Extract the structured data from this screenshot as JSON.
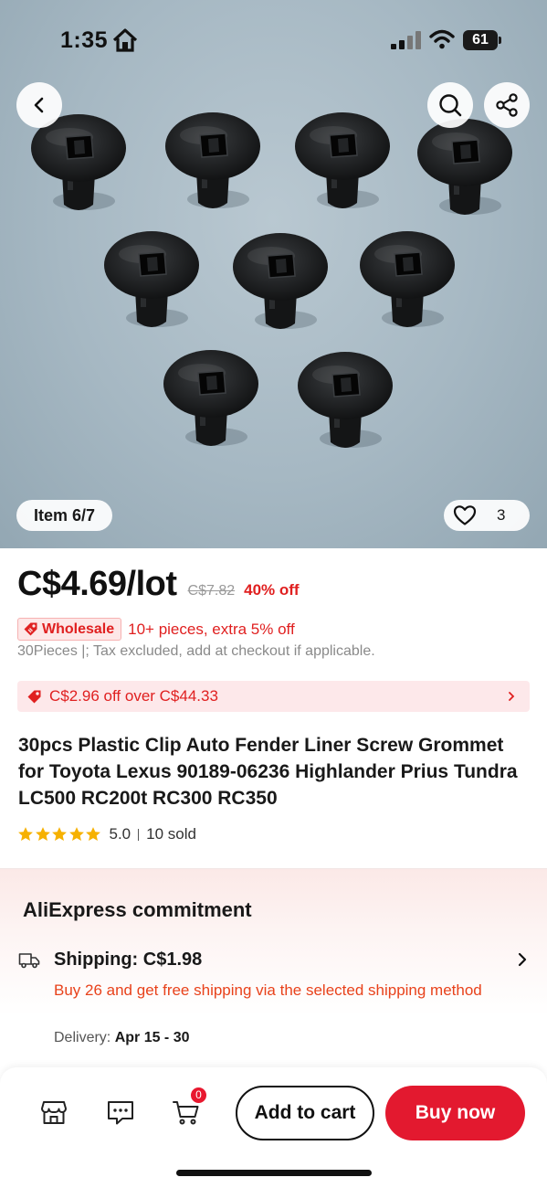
{
  "status_bar": {
    "time": "1:35",
    "battery": "61"
  },
  "gallery": {
    "item_indicator": "Item 6/7",
    "like_count": "3"
  },
  "pricing": {
    "price": "C$4.69",
    "unit": "/lot",
    "original_price": "C$7.82",
    "discount": "40% off",
    "wholesale_badge": "Wholesale",
    "wholesale_offer": "10+ pieces, extra 5% off",
    "tax_note": "30Pieces |; Tax excluded, add at checkout if applicable."
  },
  "coupon": {
    "text": "C$2.96 off over C$44.33"
  },
  "product": {
    "title": "30pcs Plastic Clip Auto Fender Liner Screw Grommet for Toyota Lexus 90189-06236 Highlander Prius Tundra LC500 RC200t RC300 RC350",
    "rating": "5.0",
    "rating_stars": 5,
    "sold": "10 sold"
  },
  "commitment": {
    "title": "AliExpress commitment",
    "shipping_label": "Shipping: C$1.98",
    "shipping_promo": "Buy 26 and get free shipping via the selected shipping method",
    "delivery_label": "Delivery:",
    "delivery_dates": "Apr 15 - 30"
  },
  "bottom_bar": {
    "cart_count": "0",
    "add_to_cart": "Add to cart",
    "buy_now": "Buy now"
  },
  "colors": {
    "accent_red": "#e02020",
    "buy_button": "#e3192f",
    "shipping_orange": "#e8421b",
    "star_yellow": "#f6b100"
  },
  "icons": [
    "home-icon",
    "signal-icon",
    "wifi-icon",
    "back-icon",
    "search-icon",
    "share-icon",
    "heart-icon",
    "tag-icon",
    "chevron-right-icon",
    "truck-icon",
    "store-icon",
    "chat-icon",
    "cart-icon",
    "star-icon"
  ]
}
